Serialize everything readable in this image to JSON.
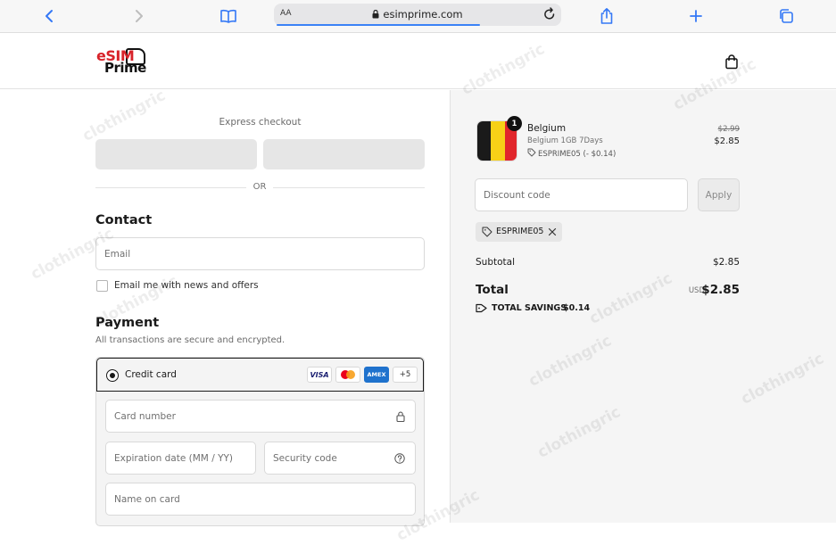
{
  "browser": {
    "text_size_label": "AA",
    "url": "esimprime.com",
    "load_progress": 0.72
  },
  "header": {
    "logo_text_top": "eSIM",
    "logo_text_bottom": "Prime"
  },
  "checkout": {
    "express_label": "Express checkout",
    "or_label": "OR",
    "contact_heading": "Contact",
    "email_placeholder": "Email",
    "email_value": "",
    "news_label": "Email me with news and offers",
    "news_checked": false,
    "payment_heading": "Payment",
    "payment_subtitle": "All transactions are secure and encrypted.",
    "method_label": "Credit card",
    "card_brands": [
      "VISA",
      "MC",
      "AMEX"
    ],
    "more_brands": "+5",
    "card_number_placeholder": "Card number",
    "expiry_placeholder": "Expiration date (MM / YY)",
    "cvv_placeholder": "Security code",
    "name_placeholder": "Name on card"
  },
  "summary": {
    "item": {
      "quantity": "1",
      "name": "Belgium",
      "variant": "Belgium 1GB 7Days",
      "discount": "ESPRIME05 (- $0.14)",
      "price_original": "$2.99",
      "price": "$2.85"
    },
    "discount_placeholder": "Discount code",
    "apply_label": "Apply",
    "applied_code": "ESPRIME05",
    "subtotal_label": "Subtotal",
    "subtotal_value": "$2.85",
    "total_label": "Total",
    "total_currency": "USD",
    "total_value": "$2.85",
    "savings_label": "TOTAL SAVINGS",
    "savings_value": "$0.14"
  },
  "watermark": "clothingric",
  "colors": {
    "accent": "#3b82f6",
    "brand_red": "#d8232a",
    "flag_black": "#1a1a1a",
    "flag_yellow": "#f7d117",
    "flag_red": "#e1262c"
  }
}
